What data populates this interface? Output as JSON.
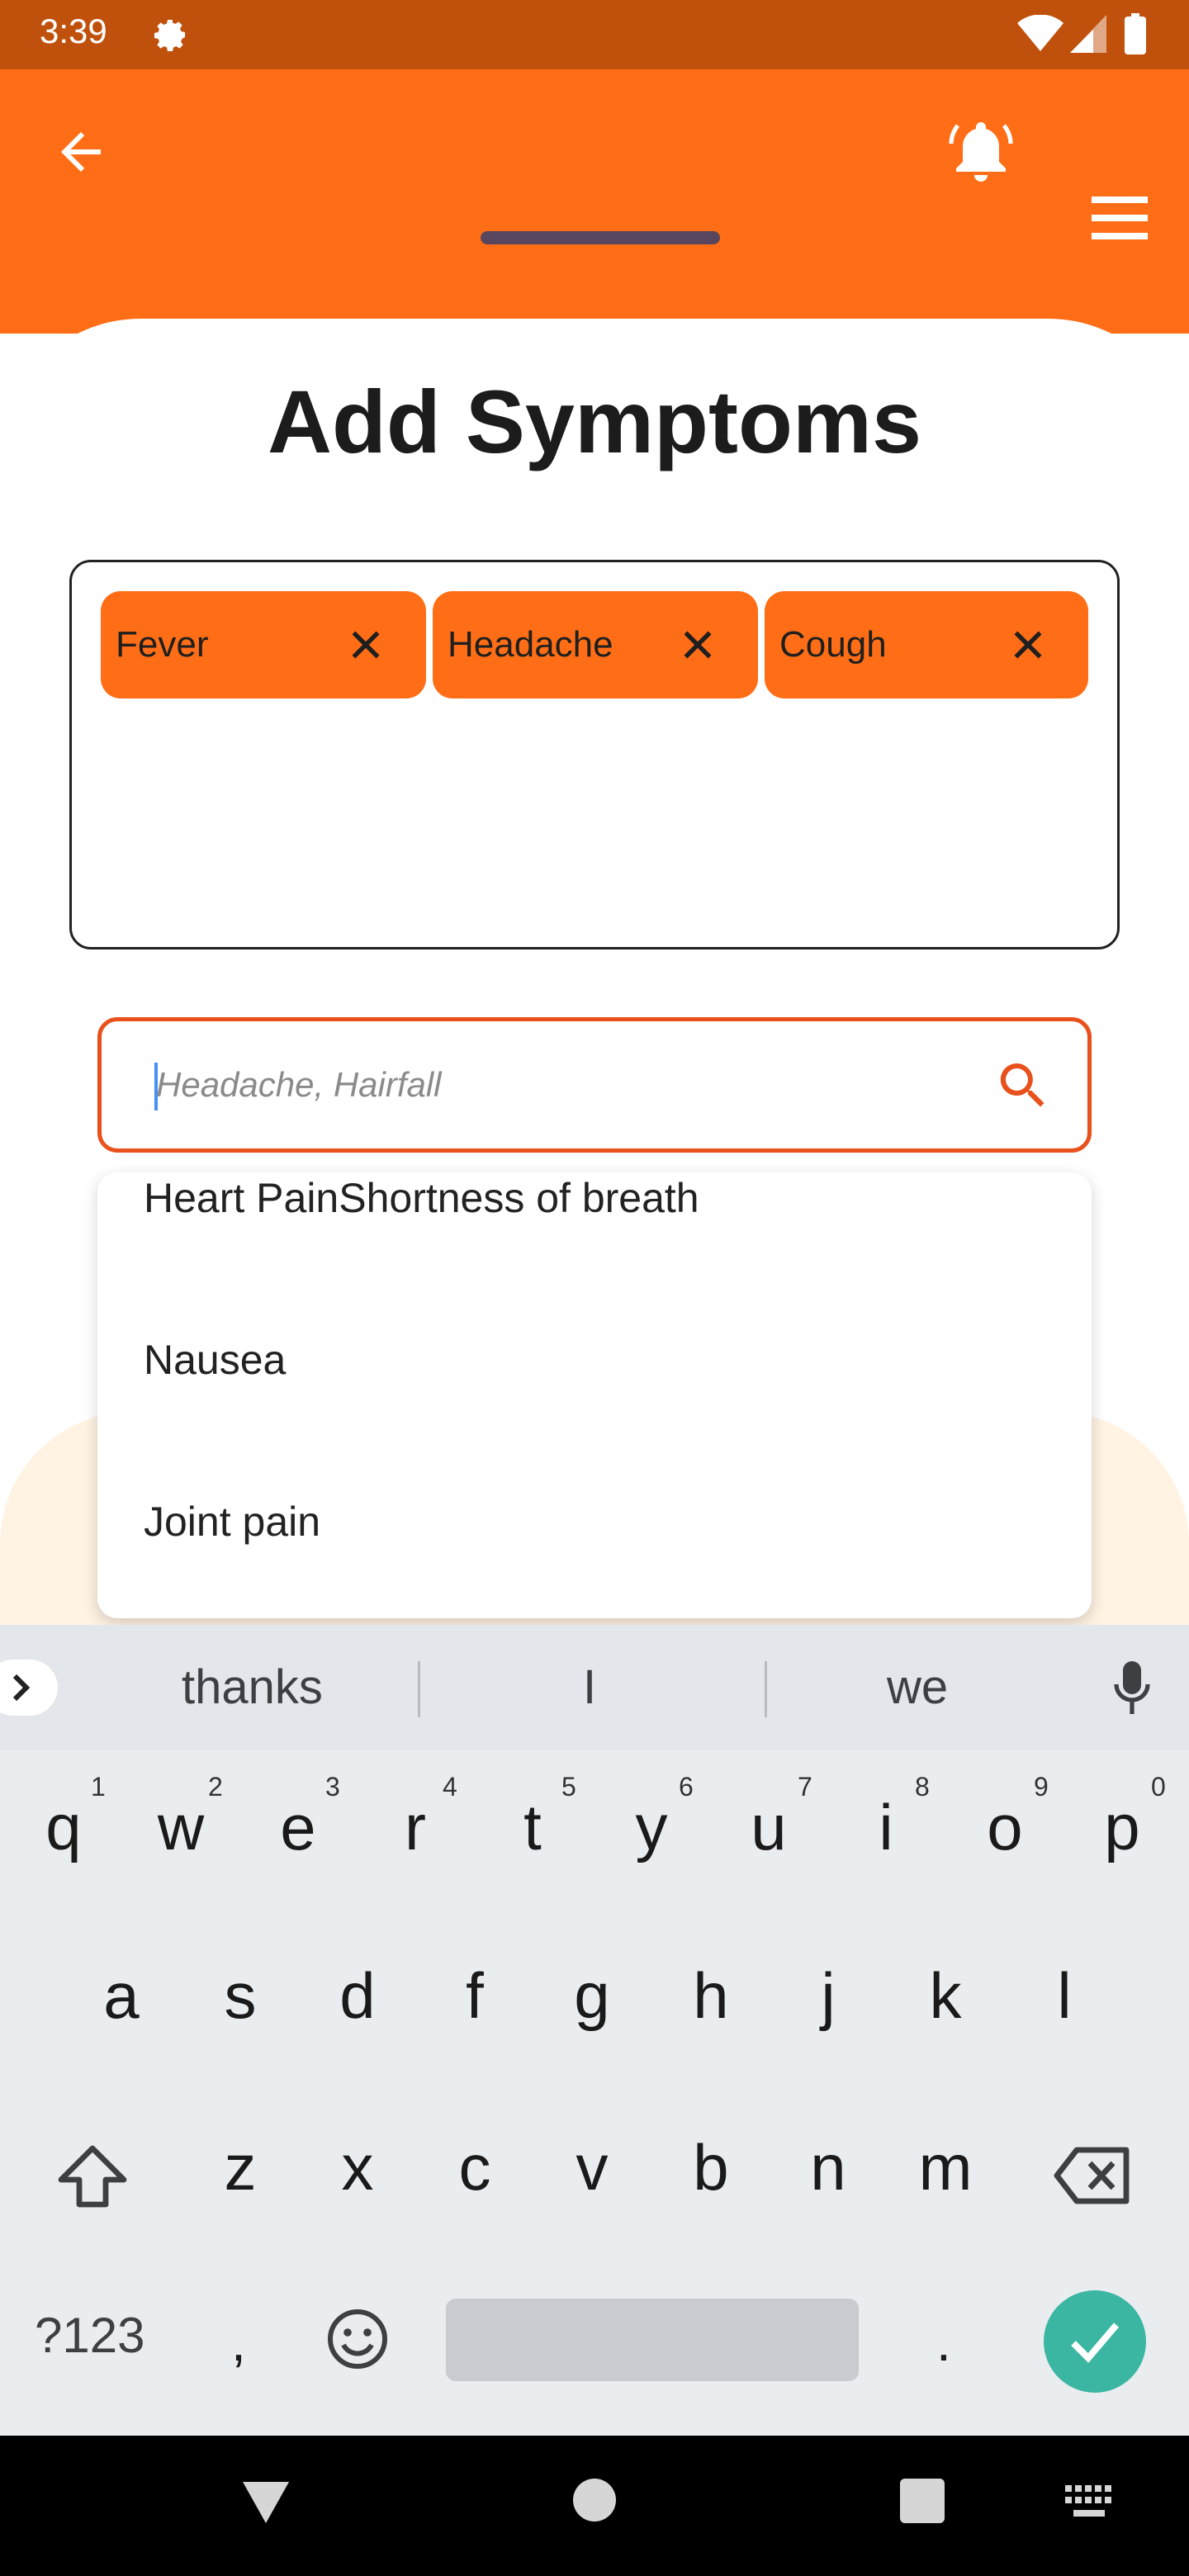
{
  "status_bar": {
    "time": "3:39"
  },
  "page": {
    "title": "Add Symptoms"
  },
  "chips": [
    {
      "label": "Fever"
    },
    {
      "label": "Headache"
    },
    {
      "label": "Cough"
    }
  ],
  "search": {
    "placeholder": "Headache, Hairfall"
  },
  "dropdown": {
    "items": [
      {
        "label": "Heart PainShortness of breath"
      },
      {
        "label": "Nausea"
      },
      {
        "label": "Joint pain"
      }
    ]
  },
  "keyboard": {
    "suggestions": [
      "thanks",
      "I",
      "we"
    ],
    "row1": [
      "q",
      "w",
      "e",
      "r",
      "t",
      "y",
      "u",
      "i",
      "o",
      "p"
    ],
    "row1_nums": [
      "1",
      "2",
      "3",
      "4",
      "5",
      "6",
      "7",
      "8",
      "9",
      "0"
    ],
    "row2": [
      "a",
      "s",
      "d",
      "f",
      "g",
      "h",
      "j",
      "k",
      "l"
    ],
    "row3": [
      "z",
      "x",
      "c",
      "v",
      "b",
      "n",
      "m"
    ],
    "symbols_key": "?123",
    "comma": ",",
    "period": "."
  },
  "colors": {
    "accent": "#ff6e16",
    "status_bar": "#c0510c",
    "search_border": "#e8501c",
    "enter": "#3bb6a2"
  }
}
